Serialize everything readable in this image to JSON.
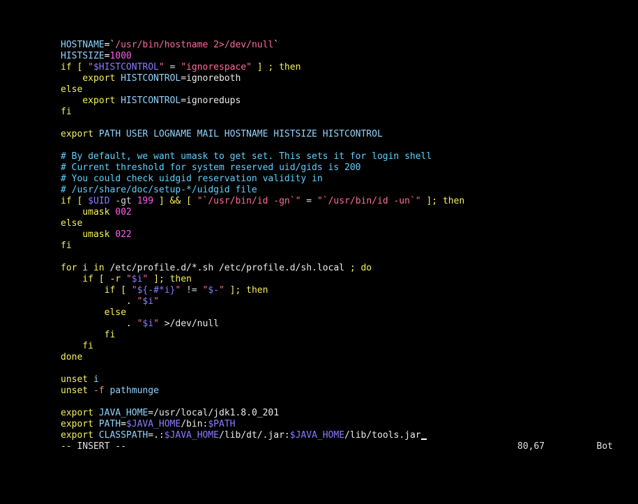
{
  "editor": {
    "lines": [
      [
        {
          "t": "HOSTNAME",
          "c": "id"
        },
        {
          "t": "=`",
          "c": "op"
        },
        {
          "t": "/usr/bin/hostname 2>/dev/null",
          "c": "str"
        },
        {
          "t": "`",
          "c": "op"
        }
      ],
      [
        {
          "t": "HISTSIZE",
          "c": "id"
        },
        {
          "t": "=",
          "c": "op"
        },
        {
          "t": "1000",
          "c": "num"
        }
      ],
      [
        {
          "t": "if",
          "c": "kw"
        },
        {
          "t": " [ ",
          "c": "kw"
        },
        {
          "t": "\"",
          "c": "str"
        },
        {
          "t": "$HISTCONTROL",
          "c": "var"
        },
        {
          "t": "\"",
          "c": "str"
        },
        {
          "t": " = ",
          "c": "plain"
        },
        {
          "t": "\"ignorespace\"",
          "c": "str"
        },
        {
          "t": " ] ; ",
          "c": "kw"
        },
        {
          "t": "then",
          "c": "kw"
        }
      ],
      [
        {
          "t": "    export ",
          "c": "cmd"
        },
        {
          "t": "HISTCONTROL",
          "c": "id"
        },
        {
          "t": "=ignoreboth",
          "c": "pathc"
        }
      ],
      [
        {
          "t": "else",
          "c": "kw"
        }
      ],
      [
        {
          "t": "    export ",
          "c": "cmd"
        },
        {
          "t": "HISTCONTROL",
          "c": "id"
        },
        {
          "t": "=ignoredups",
          "c": "pathc"
        }
      ],
      [
        {
          "t": "fi",
          "c": "kw"
        }
      ],
      [],
      [
        {
          "t": "export ",
          "c": "cmd"
        },
        {
          "t": "PATH USER LOGNAME MAIL HOSTNAME HISTSIZE HISTCONTROL",
          "c": "id"
        }
      ],
      [],
      [
        {
          "t": "# By default, we want umask to get set. This sets it for login shell",
          "c": "cmt"
        }
      ],
      [
        {
          "t": "# Current threshold for system reserved uid/gids is 200",
          "c": "cmt"
        }
      ],
      [
        {
          "t": "# You could check uidgid reservation validity in",
          "c": "cmt"
        }
      ],
      [
        {
          "t": "# /usr/share/doc/setup-*/uidgid file",
          "c": "cmt"
        }
      ],
      [
        {
          "t": "if",
          "c": "kw"
        },
        {
          "t": " [ ",
          "c": "kw"
        },
        {
          "t": "$UID",
          "c": "var"
        },
        {
          "t": " -gt ",
          "c": "plain"
        },
        {
          "t": "199",
          "c": "num"
        },
        {
          "t": " ] && [ ",
          "c": "kw"
        },
        {
          "t": "\"`",
          "c": "str"
        },
        {
          "t": "/usr/bin/id -gn",
          "c": "str"
        },
        {
          "t": "`\"",
          "c": "str"
        },
        {
          "t": " = ",
          "c": "plain"
        },
        {
          "t": "\"`",
          "c": "str"
        },
        {
          "t": "/usr/bin/id -un",
          "c": "str"
        },
        {
          "t": "`\"",
          "c": "str"
        },
        {
          "t": " ]; ",
          "c": "kw"
        },
        {
          "t": "then",
          "c": "kw"
        }
      ],
      [
        {
          "t": "    umask ",
          "c": "cmd"
        },
        {
          "t": "002",
          "c": "num"
        }
      ],
      [
        {
          "t": "else",
          "c": "kw"
        }
      ],
      [
        {
          "t": "    umask ",
          "c": "cmd"
        },
        {
          "t": "022",
          "c": "num"
        }
      ],
      [
        {
          "t": "fi",
          "c": "kw"
        }
      ],
      [],
      [
        {
          "t": "for",
          "c": "kw"
        },
        {
          "t": " i ",
          "c": "plain"
        },
        {
          "t": "in",
          "c": "kw"
        },
        {
          "t": " /etc/profile.d/*.sh /etc/profile.d/sh.local ",
          "c": "pathc"
        },
        {
          "t": "; ",
          "c": "kw"
        },
        {
          "t": "do",
          "c": "kw"
        }
      ],
      [
        {
          "t": "    if",
          "c": "kw"
        },
        {
          "t": " [ -r ",
          "c": "kw"
        },
        {
          "t": "\"",
          "c": "str"
        },
        {
          "t": "$i",
          "c": "var"
        },
        {
          "t": "\"",
          "c": "str"
        },
        {
          "t": " ]; ",
          "c": "kw"
        },
        {
          "t": "then",
          "c": "kw"
        }
      ],
      [
        {
          "t": "        if",
          "c": "kw"
        },
        {
          "t": " [ ",
          "c": "kw"
        },
        {
          "t": "\"",
          "c": "str"
        },
        {
          "t": "${-#*i}",
          "c": "var"
        },
        {
          "t": "\"",
          "c": "str"
        },
        {
          "t": " != ",
          "c": "plain"
        },
        {
          "t": "\"",
          "c": "str"
        },
        {
          "t": "$-",
          "c": "var"
        },
        {
          "t": "\"",
          "c": "str"
        },
        {
          "t": " ]; ",
          "c": "kw"
        },
        {
          "t": "then",
          "c": "kw"
        }
      ],
      [
        {
          "t": "            . ",
          "c": "pathc"
        },
        {
          "t": "\"",
          "c": "str"
        },
        {
          "t": "$i",
          "c": "var"
        },
        {
          "t": "\"",
          "c": "str"
        }
      ],
      [
        {
          "t": "        else",
          "c": "kw"
        }
      ],
      [
        {
          "t": "            . ",
          "c": "pathc"
        },
        {
          "t": "\"",
          "c": "str"
        },
        {
          "t": "$i",
          "c": "var"
        },
        {
          "t": "\"",
          "c": "str"
        },
        {
          "t": " >/dev/null",
          "c": "pathc"
        }
      ],
      [
        {
          "t": "        fi",
          "c": "kw"
        }
      ],
      [
        {
          "t": "    fi",
          "c": "kw"
        }
      ],
      [
        {
          "t": "done",
          "c": "kw"
        }
      ],
      [],
      [
        {
          "t": "unset ",
          "c": "cmd"
        },
        {
          "t": "i",
          "c": "id"
        }
      ],
      [
        {
          "t": "unset ",
          "c": "cmd"
        },
        {
          "t": "-f",
          "c": "opt"
        },
        {
          "t": " pathmunge",
          "c": "id"
        }
      ],
      [],
      [
        {
          "t": "export ",
          "c": "cmd"
        },
        {
          "t": "JAVA_HOME",
          "c": "id"
        },
        {
          "t": "=/usr/local/jdk1.8.0_201",
          "c": "pathc"
        }
      ],
      [
        {
          "t": "export ",
          "c": "cmd"
        },
        {
          "t": "PATH",
          "c": "id"
        },
        {
          "t": "=",
          "c": "op"
        },
        {
          "t": "$JAVA_HOME",
          "c": "var"
        },
        {
          "t": "/bin:",
          "c": "pathc"
        },
        {
          "t": "$PATH",
          "c": "var"
        }
      ],
      [
        {
          "t": "export ",
          "c": "cmd"
        },
        {
          "t": "CLASSPATH",
          "c": "id"
        },
        {
          "t": "=.:",
          "c": "pathc"
        },
        {
          "t": "$JAVA_HOME",
          "c": "var"
        },
        {
          "t": "/lib/dt/.jar:",
          "c": "pathc"
        },
        {
          "t": "$JAVA_HOME",
          "c": "var"
        },
        {
          "t": "/lib/tools.jar",
          "c": "pathc"
        },
        {
          "t": "",
          "c": "cursor"
        }
      ]
    ]
  },
  "status": {
    "mode": "-- INSERT --",
    "position": "80,67",
    "scroll": "Bot"
  },
  "colors": {
    "background": "#000000",
    "keyword": "#f5f05a",
    "identifier": "#8fd4ff",
    "string": "#ff6b9e",
    "variable": "#8a7bff",
    "number": "#ff5cf0",
    "comment": "#5fd1ff"
  }
}
